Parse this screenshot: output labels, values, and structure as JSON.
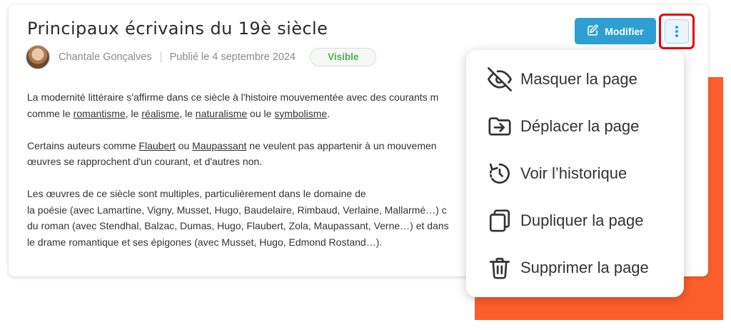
{
  "page": {
    "title": "Principaux écrivains du 19è siècle",
    "author": "Chantale Gonçalves",
    "published": "Publié le 4 septembre 2024",
    "status_badge": "Visible"
  },
  "toolbar": {
    "edit_label": "Modifier"
  },
  "content": {
    "p1_l1": "La modernité littéraire s'affirme dans ce siècle à l'histoire mouvementée avec des courants m",
    "p1_l2_a": "comme le ",
    "p1_l2_link1": "romantisme",
    "p1_l2_b": ", le ",
    "p1_l2_link2": "réalisme",
    "p1_l2_c": ", le ",
    "p1_l2_link3": "naturalisme",
    "p1_l2_d": " ou le ",
    "p1_l2_link4": "symbolisme",
    "p1_l2_e": ".",
    "p2_l1_a": "Certains auteurs comme ",
    "p2_l1_link1": "Flaubert",
    "p2_l1_b": " ou ",
    "p2_l1_link2": "Maupassant",
    "p2_l1_c": " ne veulent pas appartenir à un mouvemen",
    "p2_l2": "œuvres se rapprochent d'un courant, et d'autres non.",
    "p3_l1": "Les œuvres de ce siècle sont multiples, particulièrement dans le domaine de",
    "p3_l2": "la poésie (avec Lamartine, Vigny, Musset, Hugo, Baudelaire, Rimbaud, Verlaine, Mallarmé…) c",
    "p3_l3": "du roman (avec Stendhal, Balzac, Dumas, Hugo, Flaubert, Zola, Maupassant, Verne…) et dans",
    "p3_l4": "le drame romantique et ses épigones (avec Musset, Hugo, Edmond Rostand…)."
  },
  "menu": {
    "items": [
      {
        "label": "Masquer la page",
        "icon": "eye-off-icon"
      },
      {
        "label": "Déplacer la page",
        "icon": "folder-move-icon"
      },
      {
        "label": "Voir l’historique",
        "icon": "history-icon"
      },
      {
        "label": "Dupliquer la page",
        "icon": "duplicate-icon"
      },
      {
        "label": "Supprimer la page",
        "icon": "trash-icon"
      }
    ]
  },
  "colors": {
    "primary_button": "#2e9fd3",
    "highlight_outline": "#e8000b",
    "visible_badge_text": "#4caf50",
    "decor_orange": "#fc5e2b"
  }
}
